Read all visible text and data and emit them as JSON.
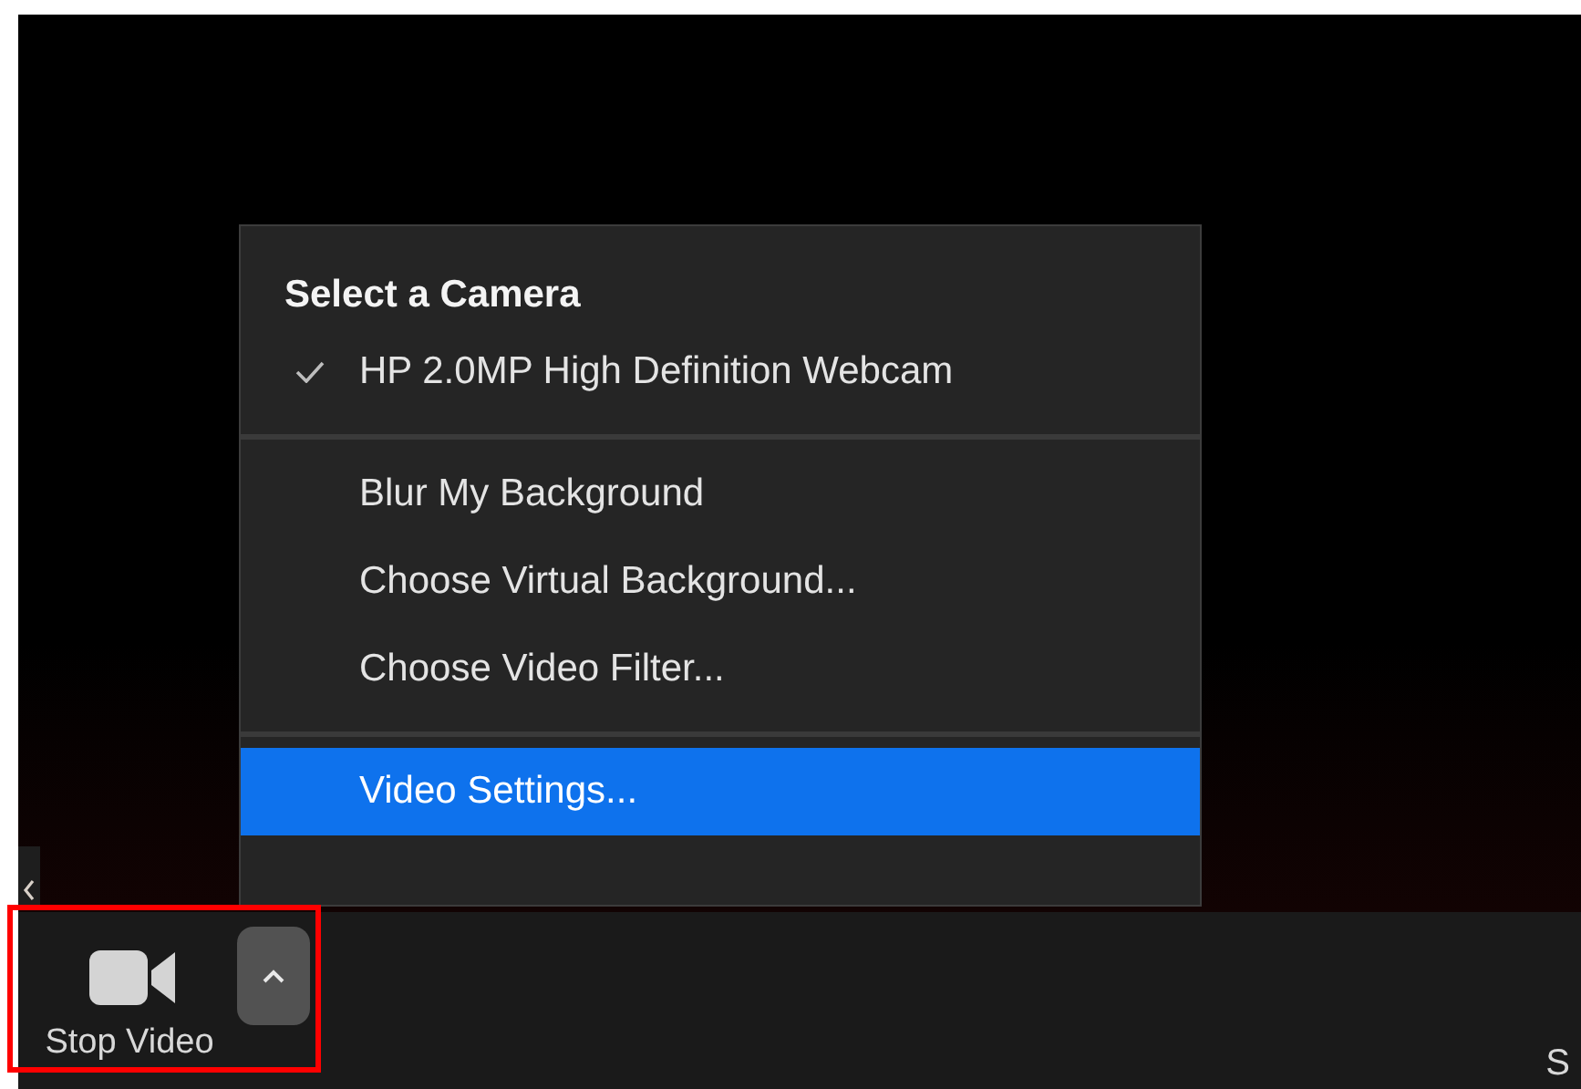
{
  "menu": {
    "sections": [
      {
        "heading": "Select a Camera",
        "items": [
          {
            "label": "HP 2.0MP High Definition Webcam",
            "checked": true,
            "selected": false
          }
        ]
      },
      {
        "items": [
          {
            "label": "Blur My Background",
            "checked": false,
            "selected": false
          },
          {
            "label": "Choose Virtual Background...",
            "checked": false,
            "selected": false
          },
          {
            "label": "Choose Video Filter...",
            "checked": false,
            "selected": false
          }
        ]
      },
      {
        "items": [
          {
            "label": "Video Settings...",
            "checked": false,
            "selected": true
          }
        ]
      }
    ]
  },
  "toolbar": {
    "buttons": [
      {
        "kind": "video",
        "label": "Stop Video"
      },
      {
        "kind": "cut",
        "label": "S"
      }
    ]
  }
}
